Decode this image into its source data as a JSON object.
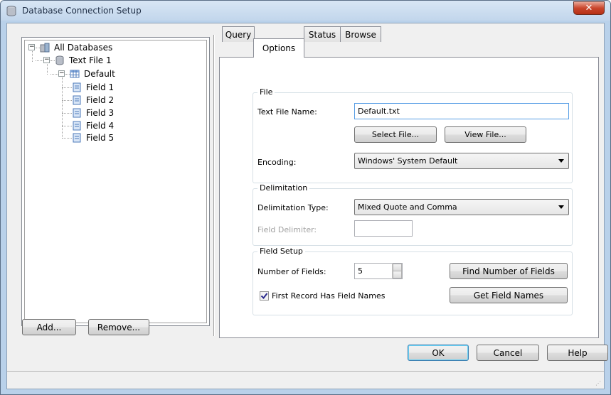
{
  "window": {
    "title": "Database Connection Setup"
  },
  "tree": {
    "root": "All Databases",
    "db": "Text File 1",
    "table": "Default",
    "fields": [
      "Field 1",
      "Field 2",
      "Field 3",
      "Field 4",
      "Field 5"
    ]
  },
  "left_buttons": {
    "add": "Add...",
    "remove": "Remove..."
  },
  "tabs": [
    "Query",
    "Options",
    "Status",
    "Browse"
  ],
  "file_group": {
    "label": "File",
    "file_name_label": "Text File Name:",
    "file_name_value": "Default.txt",
    "select_file": "Select File...",
    "view_file": "View File...",
    "encoding_label": "Encoding:",
    "encoding_value": "Windows' System Default"
  },
  "delim_group": {
    "label": "Delimitation",
    "type_label": "Delimitation Type:",
    "type_value": "Mixed Quote and Comma",
    "field_delim_label": "Field Delimiter:",
    "field_delim_value": ""
  },
  "field_setup": {
    "label": "Field Setup",
    "num_fields_label": "Number of Fields:",
    "num_fields_value": "5",
    "find_number": "Find Number of Fields",
    "first_record_label": "First Record Has Field Names",
    "first_record_checked": true,
    "get_field_names": "Get Field Names"
  },
  "dialog_buttons": {
    "ok": "OK",
    "cancel": "Cancel",
    "help": "Help"
  }
}
